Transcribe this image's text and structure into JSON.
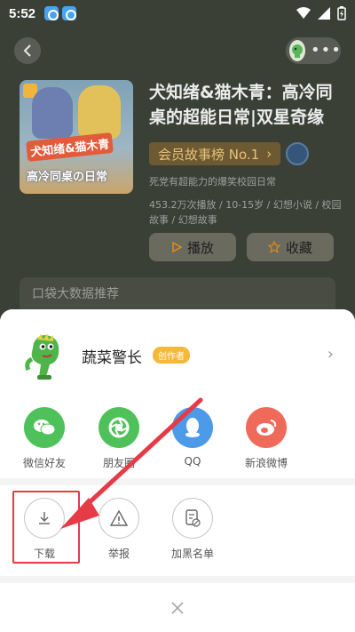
{
  "status_bar": {
    "time": "5:52"
  },
  "book": {
    "title": "犬知绪&猫木青：高冷同桌的超能日常|双星奇缘",
    "cover_text_1": "犬知绪&猫木青",
    "cover_text_2": "高冷同桌の日常",
    "rank_label": "会员故事榜 No.1",
    "description": "死党有超能力的爆笑校园日常",
    "tags": "453.2万次播放 / 10-15岁 / 幻想小说 / 校园故事 / 幻想故事",
    "play_label": "播放",
    "favorite_label": "收藏",
    "recommend_label": "口袋大数据推荐"
  },
  "sheet": {
    "author_name": "蔬菜警长",
    "creator_badge": "创作者",
    "share": [
      {
        "label": "微信好友",
        "color": "#4fc15a",
        "icon": "wechat-icon"
      },
      {
        "label": "朋友圈",
        "color": "#4fc15a",
        "icon": "moments-icon"
      },
      {
        "label": "QQ",
        "color": "#4c9ae8",
        "icon": "qq-icon"
      },
      {
        "label": "新浪微博",
        "color": "#f06a5a",
        "icon": "weibo-icon"
      }
    ],
    "actions": [
      {
        "label": "下载",
        "icon": "download-icon"
      },
      {
        "label": "举报",
        "icon": "warning-icon"
      },
      {
        "label": "加黑名单",
        "icon": "blacklist-icon"
      }
    ]
  },
  "colors": {
    "highlight": "#e53b47",
    "accent": "#f6b83a"
  }
}
